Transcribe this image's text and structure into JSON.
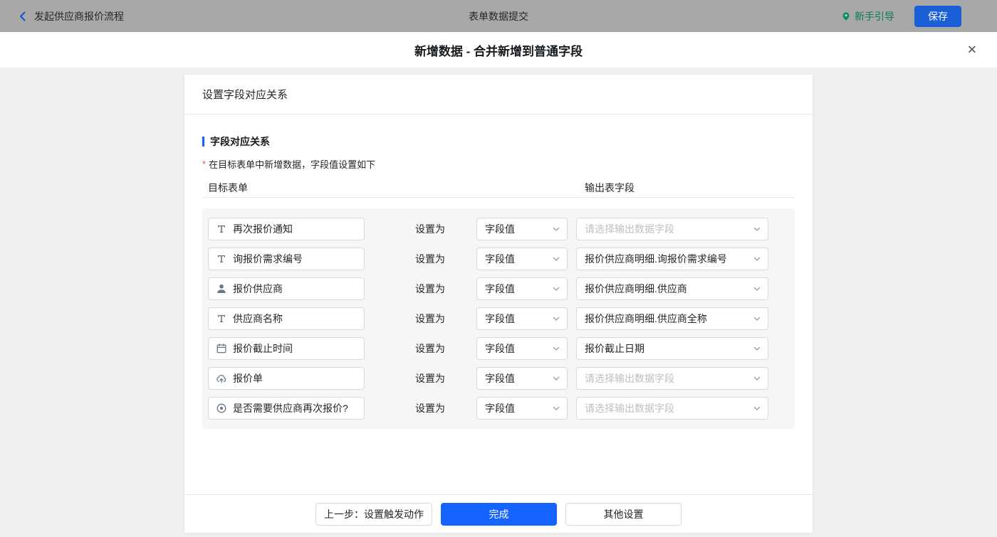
{
  "topbar": {
    "back_label": "发起供应商报价流程",
    "title": "表单数据提交",
    "guide_label": "新手引导",
    "save_label": "保存"
  },
  "header": {
    "title": "新增数据 - 合并新增到普通字段",
    "close_icon": "✕"
  },
  "card": {
    "title": "设置字段对应关系",
    "section_title": "字段对应关系",
    "required_mark": "*",
    "hint": "在目标表单中新增数据，字段值设置如下",
    "col_left": "目标表单",
    "col_right": "输出表字段",
    "set_as": "设置为",
    "rows": [
      {
        "icon": "text-field-icon",
        "field": "再次报价通知",
        "mode": "字段值",
        "output": "请选择输出数据字段",
        "placeholder": true
      },
      {
        "icon": "text-field-icon",
        "field": "询报价需求编号",
        "mode": "字段值",
        "output": "报价供应商明细.询报价需求编号",
        "placeholder": false
      },
      {
        "icon": "user-icon",
        "field": "报价供应商",
        "mode": "字段值",
        "output": "报价供应商明细.供应商",
        "placeholder": false
      },
      {
        "icon": "text-field-icon",
        "field": "供应商名称",
        "mode": "字段值",
        "output": "报价供应商明细.供应商全称",
        "placeholder": false
      },
      {
        "icon": "calendar-icon",
        "field": "报价截止时间",
        "mode": "字段值",
        "output": "报价截止日期",
        "placeholder": false
      },
      {
        "icon": "cloud-upload-icon",
        "field": "报价单",
        "mode": "字段值",
        "output": "请选择输出数据字段",
        "placeholder": true
      },
      {
        "icon": "radio-icon",
        "field": "是否需要供应商再次报价?",
        "mode": "字段值",
        "output": "请选择输出数据字段",
        "placeholder": true
      }
    ]
  },
  "footer": {
    "prev_label": "上一步：设置触发动作",
    "done_label": "完成",
    "other_label": "其他设置"
  },
  "colors": {
    "primary_blue": "#1664ff",
    "guide_green": "#0c7d55",
    "topbar_gray": "#a8a8a8",
    "required_red": "#f2564a",
    "placeholder_gray": "#bfbfbf"
  }
}
